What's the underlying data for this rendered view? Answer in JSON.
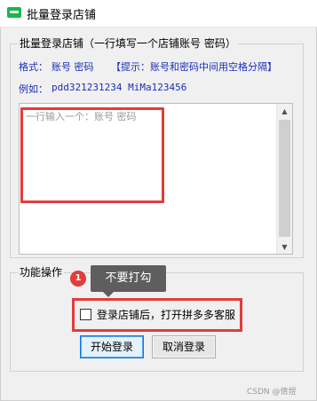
{
  "window": {
    "title": "批量登录店铺",
    "icon": "green-app-icon"
  },
  "batch_group": {
    "title": "批量登录店铺（一行填写一个店铺账号 密码）",
    "format_label": "格式：",
    "format_value": "账号 密码",
    "hint": "【提示：账号和密码中间用空格分隔】",
    "example_label": "例如：",
    "example_value": "pdd321231234  MiMa123456",
    "textarea_placeholder": "一行输入一个：账号 密码"
  },
  "function_group": {
    "title": "功能操作",
    "annotation_number": "1",
    "annotation_tooltip": "不要打勾",
    "checkbox_label": "登录店铺后，打开拼多多客服",
    "checkbox_checked": false
  },
  "buttons": {
    "start": "开始登录",
    "cancel": "取消登录"
  },
  "watermark": "CSDN @倩煜",
  "colors": {
    "hint_text": "#1a2fb8",
    "annotation_red": "#e23c3c",
    "tooltip_bg": "#5e5e5e",
    "primary_button_border": "#0f7ad8"
  }
}
